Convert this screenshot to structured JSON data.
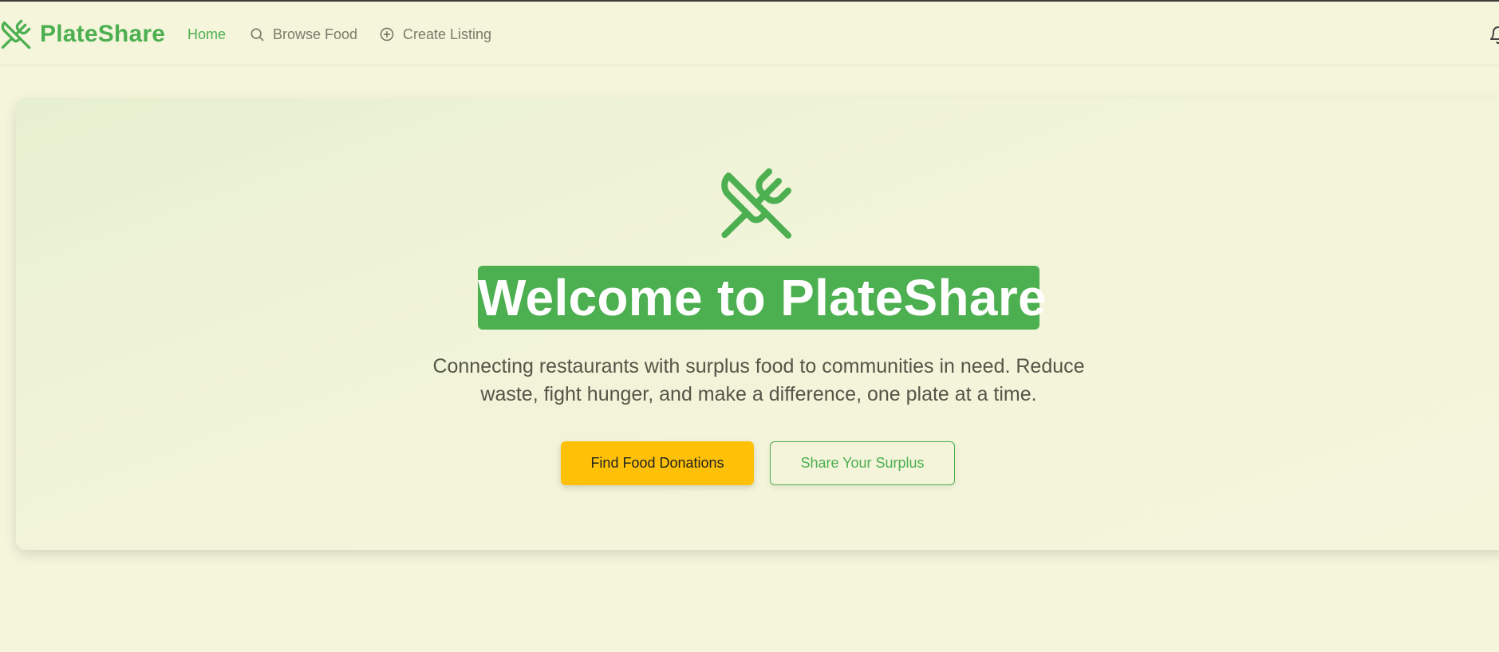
{
  "nav": {
    "brand": "PlateShare",
    "brand_icon": "utensils-crossed-icon",
    "links": [
      {
        "label": "Home",
        "active": true
      },
      {
        "label": "Browse Food",
        "icon": "search-icon"
      },
      {
        "label": "Create Listing",
        "icon": "plus-circle-icon"
      }
    ],
    "notification_icon": "bell-icon"
  },
  "hero": {
    "icon": "utensils-crossed-icon",
    "title": "Welcome to PlateShare",
    "description": "Connecting restaurants with surplus food to communities in need. Reduce waste, fight hunger, and make a difference, one plate at a time.",
    "primary_button": "Find Food Donations",
    "secondary_button": "Share Your Surplus"
  },
  "colors": {
    "brand_green": "#4caf50",
    "accent_yellow": "#ffc107",
    "background": "#f5f5dc",
    "muted_text": "#7a7a6a"
  }
}
